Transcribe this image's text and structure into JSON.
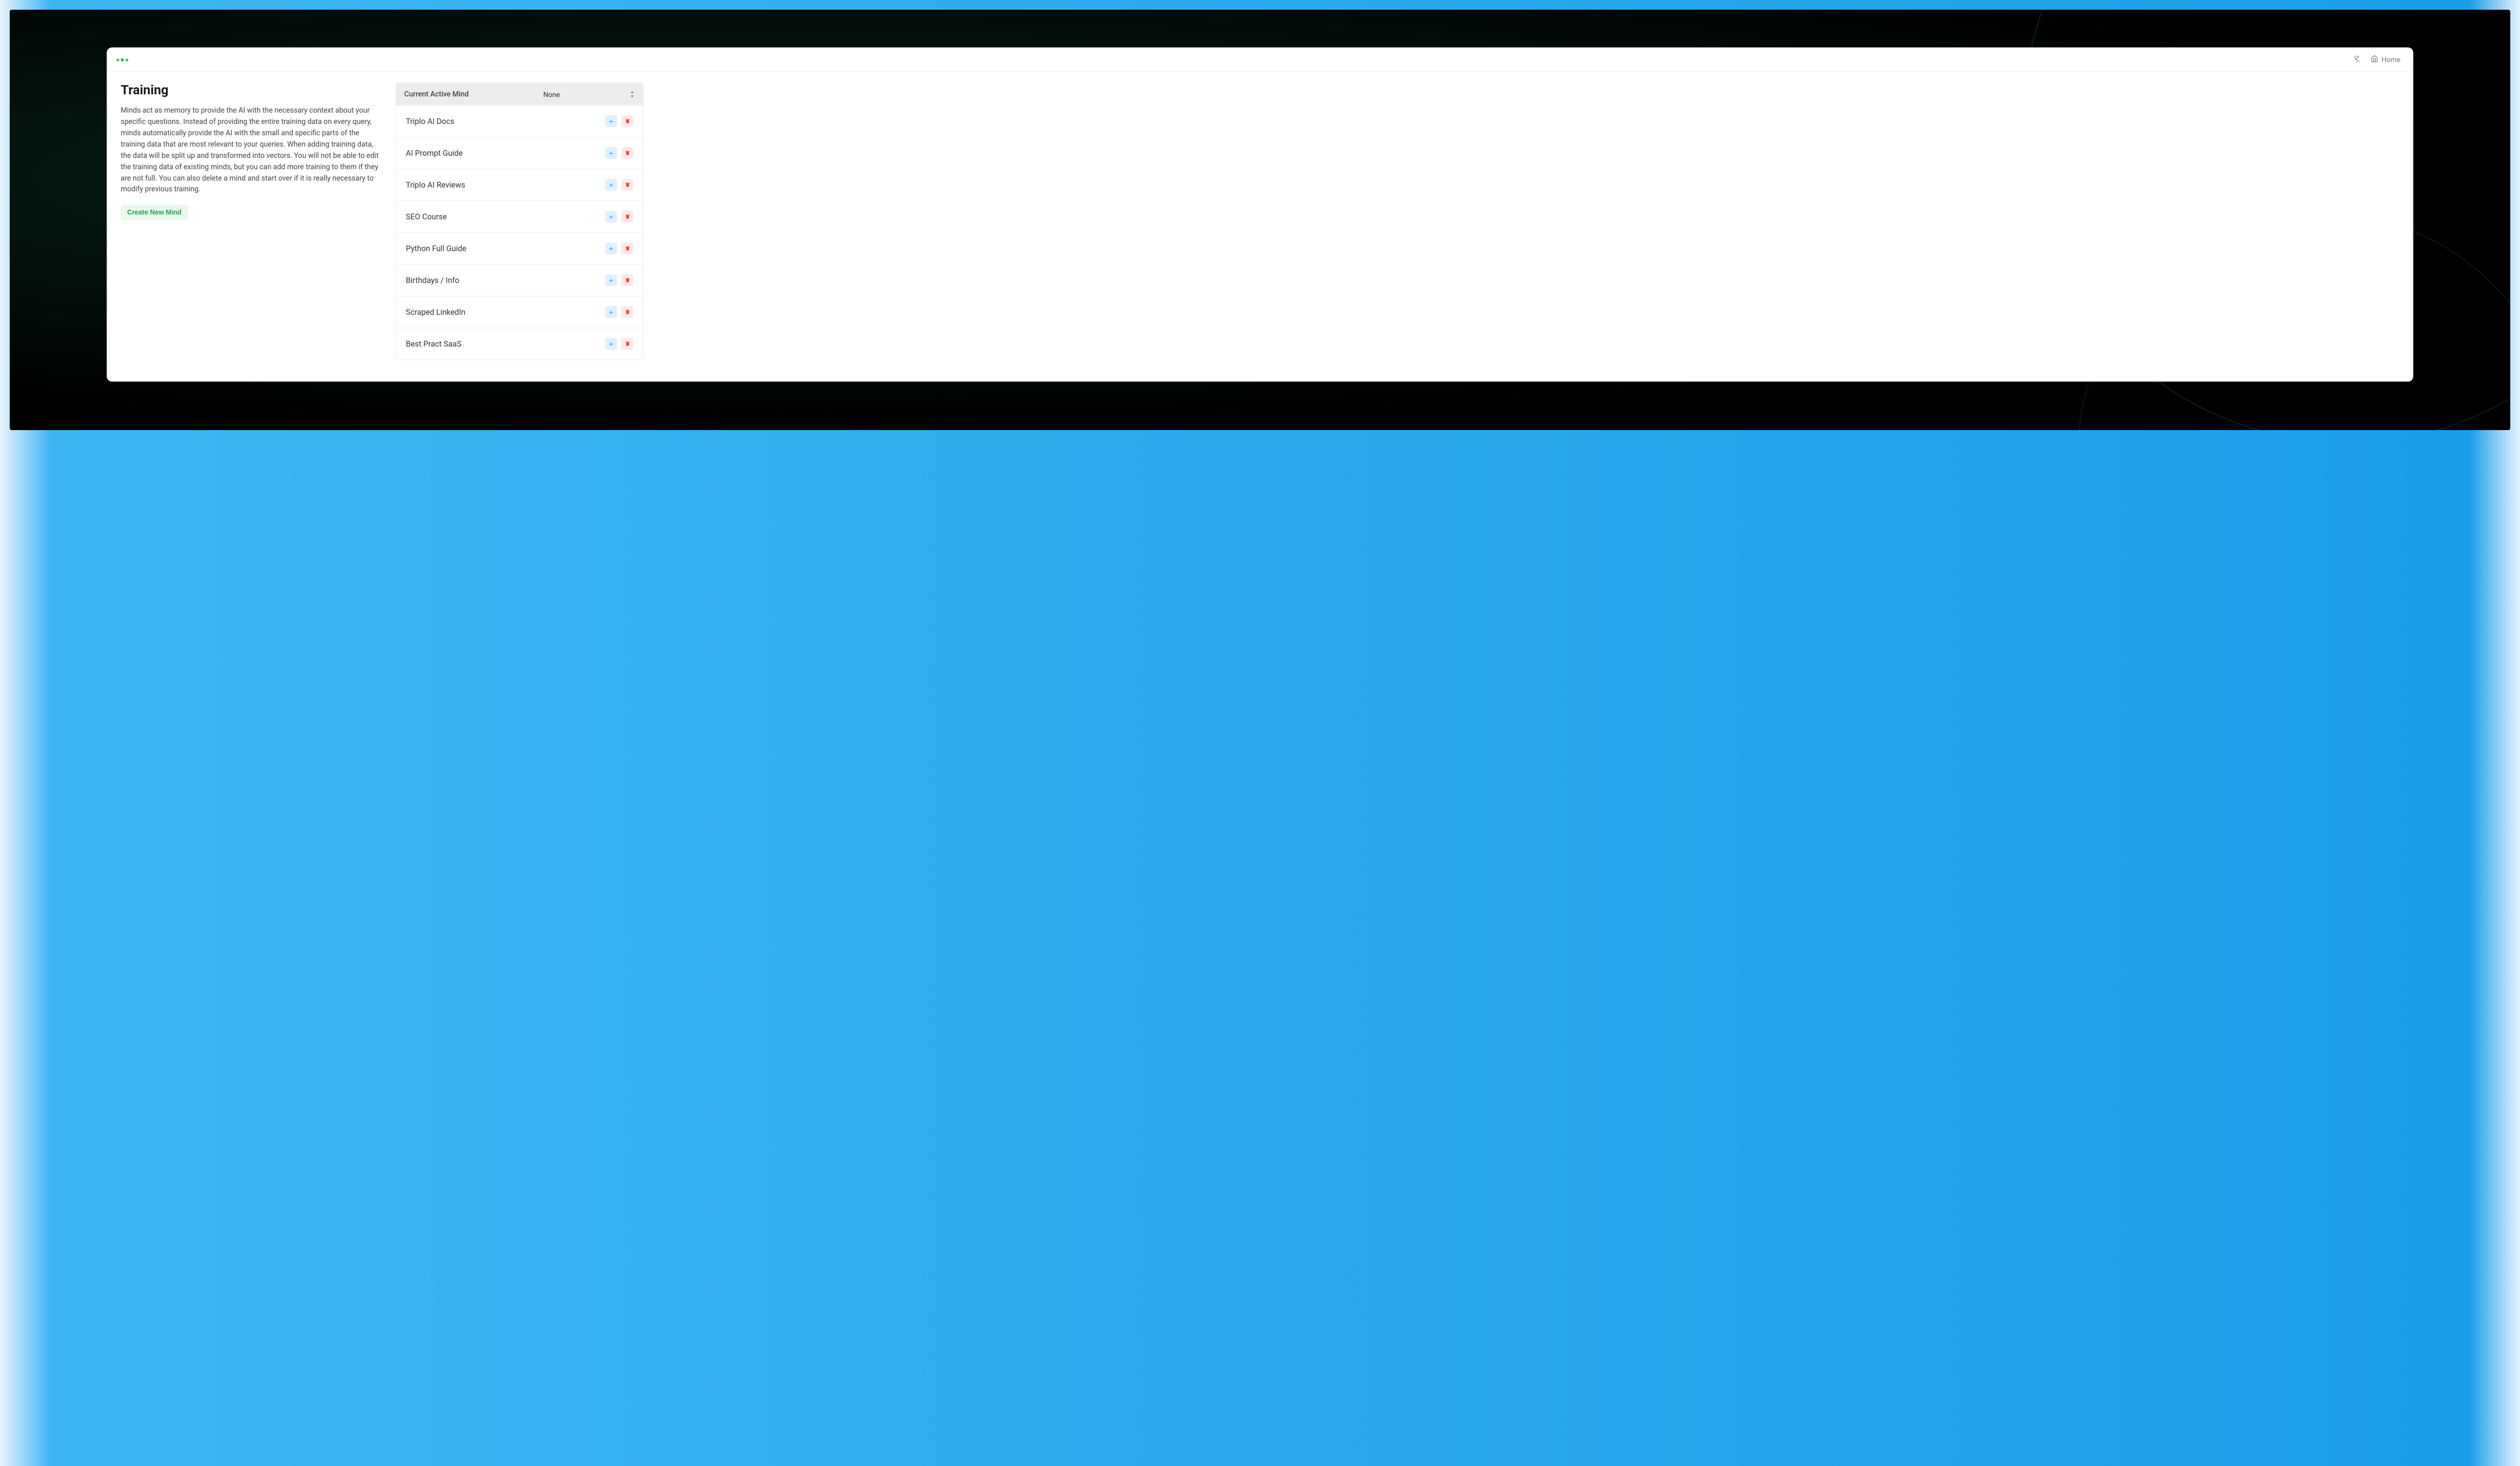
{
  "header": {
    "home_label": "Home"
  },
  "page": {
    "title": "Training",
    "description": "Minds act as memory to provide the AI with the necessary context about your specific questions. Instead of providing the entire training data on every query, minds automatically provide the AI with the small and specific parts of the training data that are most relevant to your queries. When adding training data, the data will be split up and transformed into vectors. You will not be able to edit the training data of existing minds, but you can add more training to them if they are not full. You can also delete a mind and start over if it is really necessary to modify previous training.",
    "create_button": "Create New Mind"
  },
  "active_mind": {
    "label": "Current Active Mind",
    "selected": "None"
  },
  "minds": [
    {
      "name": "Triplo AI Docs"
    },
    {
      "name": "AI Prompt Guide"
    },
    {
      "name": "Triplo AI Reviews"
    },
    {
      "name": "SEO Course"
    },
    {
      "name": "Python Full Guide"
    },
    {
      "name": "Birthdays / Info"
    },
    {
      "name": "Scraped LinkedIn"
    },
    {
      "name": "Best Pract SaaS"
    }
  ]
}
